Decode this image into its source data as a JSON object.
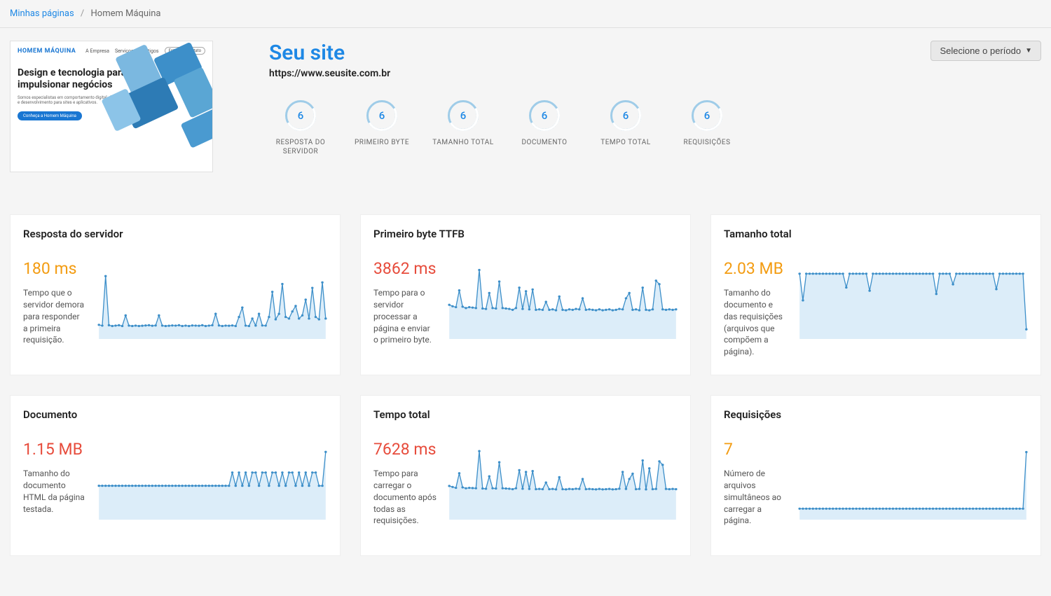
{
  "breadcrumb": {
    "root": "Minhas páginas",
    "current": "Homem Máquina"
  },
  "thumb": {
    "logo": "HOMEM MÁQUINA",
    "nav": [
      "A Empresa",
      "Serviços",
      "Artigos"
    ],
    "cta_nav": "Entre em Contato",
    "title": "Design e tecnologia para impulsionar negócios",
    "sub": "Somos especialistas em comportamento digital, design e desenvolvimento para sites e aplicativos.",
    "cta": "Conheça a Homem Máquina"
  },
  "site": {
    "title": "Seu site",
    "url": "https://www.seusite.com.br"
  },
  "period_button": "Selecione o período",
  "metrics": [
    {
      "value": "6",
      "label": "RESPOSTA DO SERVIDOR"
    },
    {
      "value": "6",
      "label": "PRIMEIRO BYTE"
    },
    {
      "value": "6",
      "label": "TAMANHO TOTAL"
    },
    {
      "value": "6",
      "label": "DOCUMENTO"
    },
    {
      "value": "6",
      "label": "TEMPO TOTAL"
    },
    {
      "value": "6",
      "label": "REQUISIÇÕES"
    }
  ],
  "panels": [
    {
      "title": "Resposta do servidor",
      "value": "180 ms",
      "status": "ok",
      "desc": "Tempo que o servidor demora para responder a primeira requisição."
    },
    {
      "title": "Primeiro byte TTFB",
      "value": "3862 ms",
      "status": "err",
      "desc": "Tempo para o servidor processar a página e enviar o primeiro byte."
    },
    {
      "title": "Tamanho total",
      "value": "2.03 MB",
      "status": "ok",
      "desc": "Tamanho do documento e das requisições (arquivos que compõem a página)."
    },
    {
      "title": "Documento",
      "value": "1.15 MB",
      "status": "err",
      "desc": "Tamanho do documento HTML da página testada."
    },
    {
      "title": "Tempo total",
      "value": "7628 ms",
      "status": "err",
      "desc": "Tempo para carregar o documento após todas as requisições."
    },
    {
      "title": "Requisições",
      "value": "7",
      "status": "ok",
      "desc": "Número de arquivos simultâneos ao carregar a página."
    }
  ],
  "chart_data": [
    {
      "type": "line",
      "title": "Resposta do servidor",
      "ylim": [
        0,
        900
      ],
      "values": [
        180,
        170,
        800,
        175,
        165,
        170,
        175,
        165,
        300,
        170,
        165,
        170,
        165,
        168,
        172,
        175,
        168,
        172,
        300,
        170,
        165,
        168,
        172,
        170,
        175,
        165,
        170,
        165,
        172,
        170,
        168,
        175,
        165,
        170,
        175,
        320,
        172,
        165,
        170,
        168,
        172,
        165,
        280,
        400,
        170,
        165,
        260,
        170,
        320,
        172,
        170,
        280,
        600,
        250,
        320,
        700,
        280,
        260,
        350,
        420,
        260,
        300,
        500,
        260,
        650,
        280,
        250,
        720,
        260
      ]
    },
    {
      "type": "line",
      "title": "Primeiro byte TTFB",
      "ylim": [
        0,
        8000
      ],
      "values": [
        3862,
        3700,
        3600,
        5500,
        3650,
        3500,
        3600,
        3550,
        3500,
        7800,
        3450,
        3400,
        5200,
        3500,
        3450,
        6500,
        3500,
        3450,
        3400,
        3300,
        3500,
        5800,
        3400,
        5400,
        3350,
        5600,
        3300,
        3350,
        3300,
        4200,
        3300,
        3350,
        3250,
        4800,
        3300,
        3250,
        3350,
        3300,
        3400,
        3350,
        4600,
        3300,
        3350,
        3300,
        3250,
        3350,
        3250,
        3300,
        3350,
        3250,
        3300,
        3400,
        3350,
        4600,
        5200,
        3300,
        3350,
        3250,
        5800,
        3300,
        3250,
        3350,
        6600,
        6200,
        3350,
        3300,
        3350,
        3300,
        3350
      ]
    },
    {
      "type": "line",
      "title": "Tamanho total",
      "ylim": [
        0,
        2.2
      ],
      "values": [
        2.03,
        1.2,
        2.03,
        2.03,
        2.03,
        2.03,
        2.03,
        2.03,
        2.03,
        2.03,
        2.03,
        2.03,
        2.03,
        2.03,
        1.6,
        2.03,
        2.03,
        2.03,
        2.03,
        2.03,
        2.03,
        1.5,
        2.03,
        2.03,
        2.03,
        2.03,
        2.03,
        2.03,
        2.03,
        2.03,
        2.03,
        2.03,
        2.03,
        2.03,
        2.03,
        2.03,
        2.03,
        2.03,
        2.03,
        2.03,
        2.03,
        1.4,
        2.03,
        2.03,
        2.03,
        2.03,
        1.7,
        2.03,
        2.03,
        2.03,
        2.03,
        2.03,
        2.03,
        2.03,
        2.03,
        2.03,
        2.03,
        2.03,
        2.03,
        1.55,
        2.03,
        2.03,
        2.03,
        2.03,
        2.03,
        2.03,
        2.03,
        2.03,
        0.3
      ]
    },
    {
      "type": "line",
      "title": "Documento",
      "ylim": [
        0,
        2.4
      ],
      "values": [
        1.15,
        1.15,
        1.15,
        1.15,
        1.15,
        1.15,
        1.15,
        1.15,
        1.15,
        1.15,
        1.15,
        1.15,
        1.15,
        1.15,
        1.15,
        1.15,
        1.15,
        1.15,
        1.15,
        1.15,
        1.15,
        1.15,
        1.15,
        1.15,
        1.15,
        1.15,
        1.15,
        1.15,
        1.15,
        1.15,
        1.15,
        1.15,
        1.15,
        1.15,
        1.15,
        1.15,
        1.15,
        1.15,
        1.15,
        1.15,
        1.6,
        1.15,
        1.6,
        1.15,
        1.6,
        1.15,
        1.6,
        1.6,
        1.15,
        1.6,
        1.6,
        1.15,
        1.6,
        1.6,
        1.15,
        1.6,
        1.15,
        1.6,
        1.6,
        1.15,
        1.6,
        1.15,
        1.6,
        1.15,
        1.6,
        1.6,
        1.15,
        1.15,
        2.3
      ]
    },
    {
      "type": "line",
      "title": "Tempo total",
      "ylim": [
        0,
        16000
      ],
      "values": [
        7628,
        7400,
        7200,
        10500,
        7300,
        7100,
        7200,
        7150,
        7100,
        15500,
        7050,
        7000,
        9800,
        7100,
        7050,
        13000,
        7100,
        7050,
        7000,
        6900,
        7100,
        11200,
        7000,
        10800,
        6950,
        11000,
        6900,
        6950,
        6900,
        8400,
        6900,
        6950,
        6850,
        9600,
        6900,
        6850,
        6950,
        6900,
        7000,
        6950,
        9200,
        6900,
        6950,
        6900,
        6850,
        6950,
        6850,
        6900,
        6950,
        6850,
        6900,
        7000,
        10800,
        6950,
        9200,
        10400,
        6900,
        6950,
        13400,
        6850,
        11600,
        6900,
        6950,
        13200,
        12400,
        6950,
        6900,
        6950,
        6900
      ]
    },
    {
      "type": "line",
      "title": "Requisições",
      "ylim": [
        0,
        45
      ],
      "values": [
        7,
        7,
        7,
        7,
        7,
        7,
        7,
        7,
        7,
        7,
        7,
        7,
        7,
        7,
        7,
        7,
        7,
        7,
        7,
        7,
        7,
        7,
        7,
        7,
        7,
        7,
        7,
        7,
        7,
        7,
        7,
        7,
        7,
        7,
        7,
        7,
        7,
        7,
        7,
        7,
        7,
        7,
        7,
        7,
        7,
        7,
        7,
        7,
        7,
        7,
        7,
        7,
        7,
        7,
        7,
        7,
        7,
        7,
        7,
        7,
        7,
        7,
        7,
        7,
        7,
        7,
        7,
        7,
        43
      ]
    }
  ]
}
